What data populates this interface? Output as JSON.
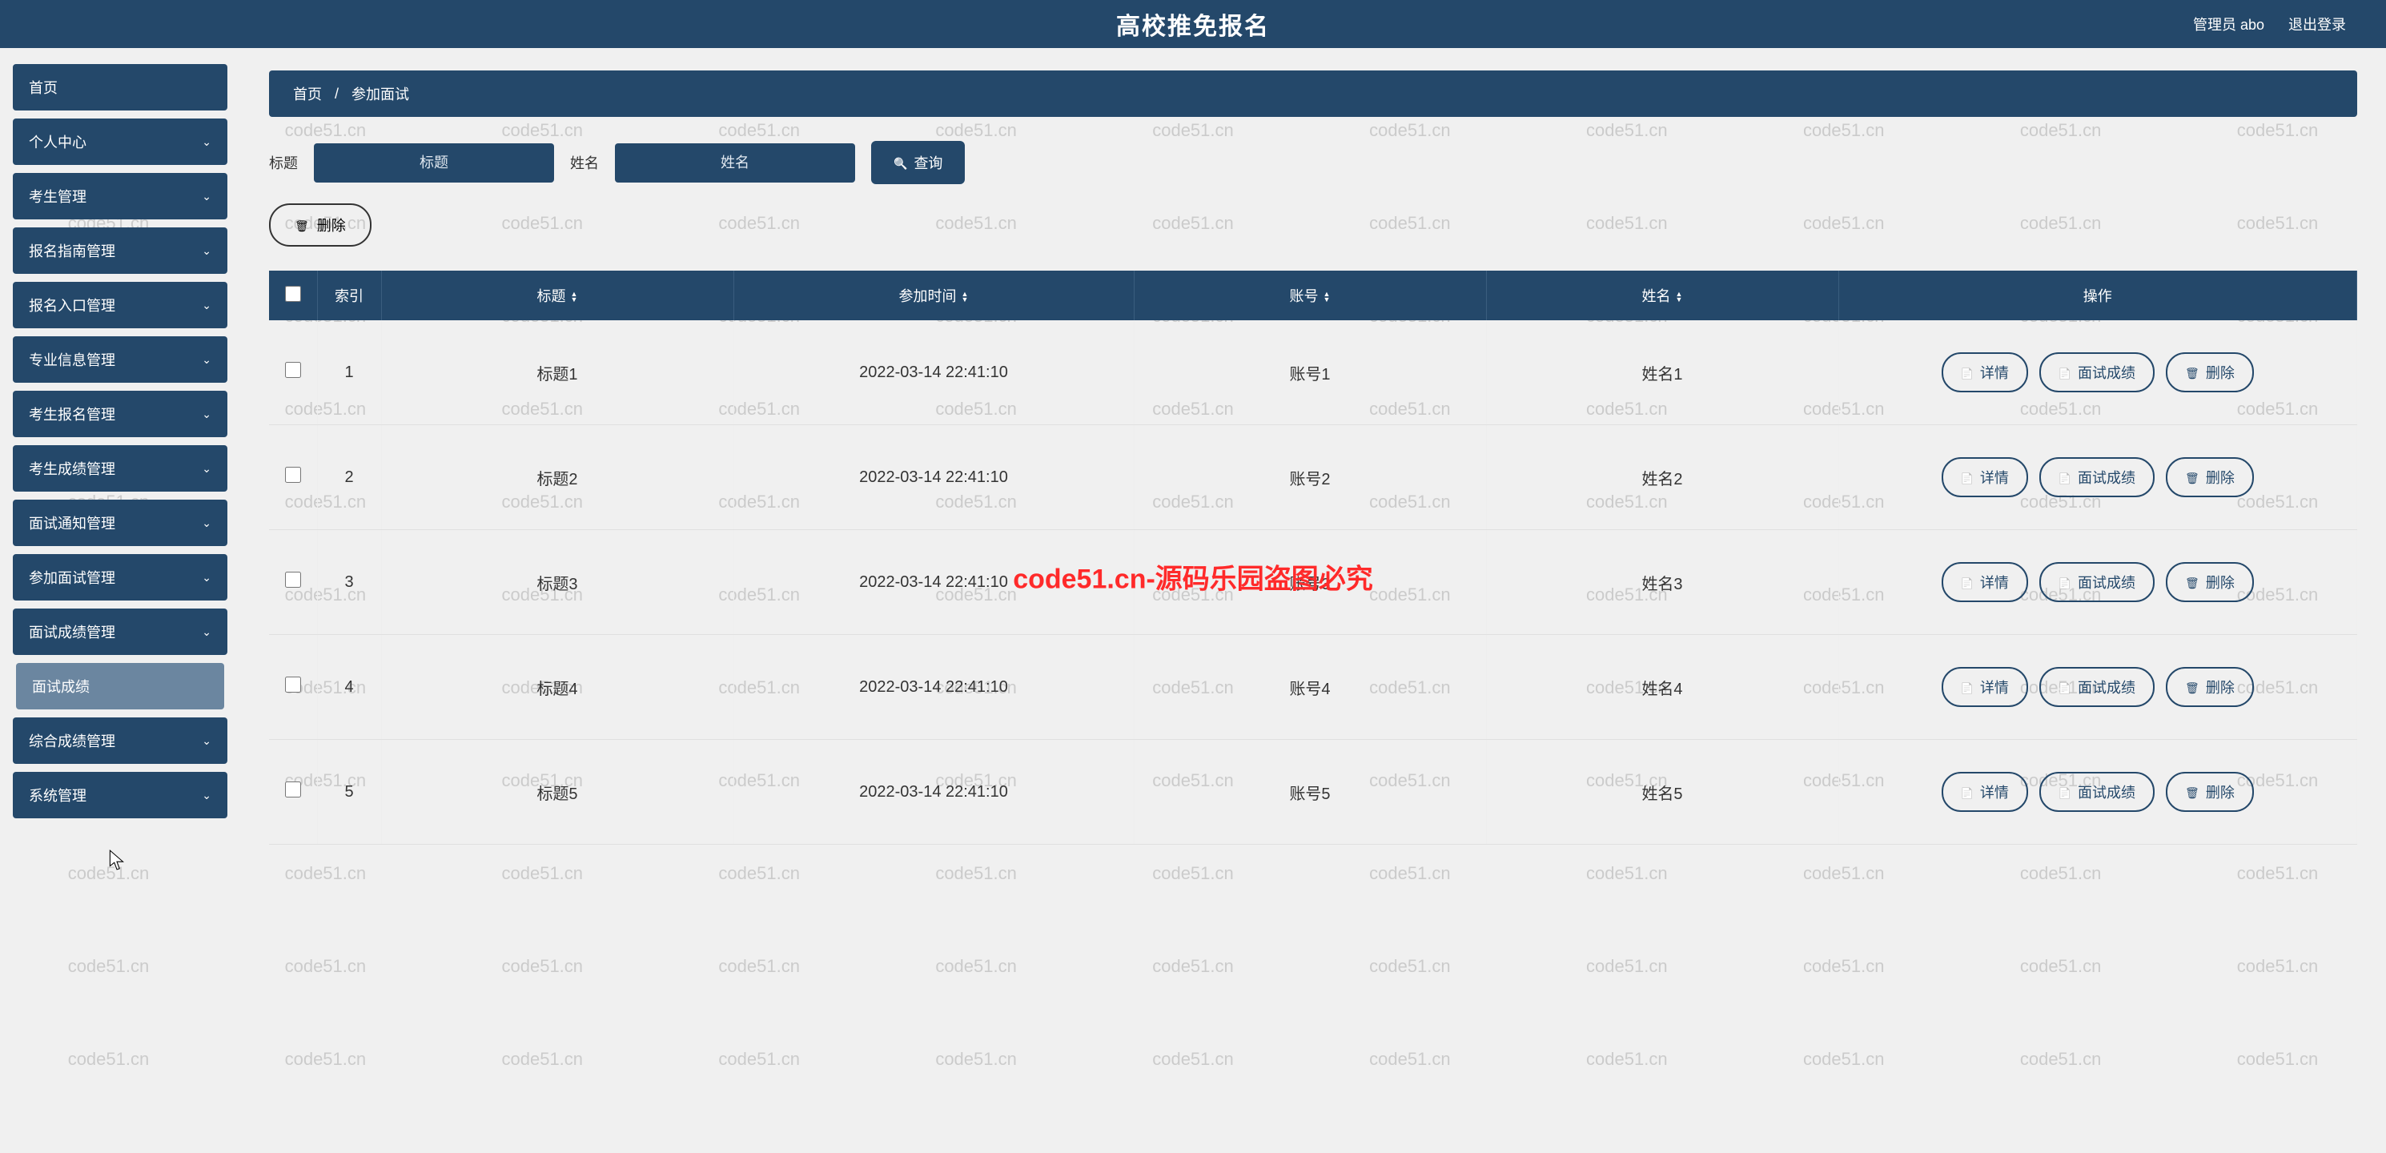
{
  "header": {
    "title": "高校推免报名",
    "user_label": "管理员 abo",
    "logout_label": "退出登录"
  },
  "sidebar": {
    "home": "首页",
    "items": [
      "个人中心",
      "考生管理",
      "报名指南管理",
      "报名入口管理",
      "专业信息管理",
      "考生报名管理",
      "考生成绩管理",
      "面试通知管理",
      "参加面试管理",
      "面试成绩管理",
      "综合成绩管理",
      "系统管理"
    ],
    "sub_item": "面试成绩"
  },
  "breadcrumb": {
    "home": "首页",
    "sep": "/",
    "current": "参加面试"
  },
  "search": {
    "title_label": "标题",
    "title_placeholder": "标题",
    "name_label": "姓名",
    "name_placeholder": "姓名",
    "query_btn": "查询"
  },
  "delete_btn": "删除",
  "table": {
    "headers": {
      "checkbox": "",
      "index": "索引",
      "title": "标题",
      "join_time": "参加时间",
      "account": "账号",
      "name": "姓名",
      "ops": "操作"
    },
    "ops_labels": {
      "detail": "详情",
      "score": "面试成绩",
      "delete": "删除"
    },
    "rows": [
      {
        "idx": "1",
        "title": "标题1",
        "time": "2022-03-14 22:41:10",
        "account": "账号1",
        "name": "姓名1"
      },
      {
        "idx": "2",
        "title": "标题2",
        "time": "2022-03-14 22:41:10",
        "account": "账号2",
        "name": "姓名2"
      },
      {
        "idx": "3",
        "title": "标题3",
        "time": "2022-03-14 22:41:10",
        "account": "账号3",
        "name": "姓名3"
      },
      {
        "idx": "4",
        "title": "标题4",
        "time": "2022-03-14 22:41:10",
        "account": "账号4",
        "name": "姓名4"
      },
      {
        "idx": "5",
        "title": "标题5",
        "time": "2022-03-14 22:41:10",
        "account": "账号5",
        "name": "姓名5"
      }
    ]
  },
  "watermark": {
    "text": "code51.cn",
    "center": "code51.cn-源码乐园盗图必究"
  },
  "colors": {
    "primary": "#24486a",
    "accent_red": "#ff2a2a"
  }
}
